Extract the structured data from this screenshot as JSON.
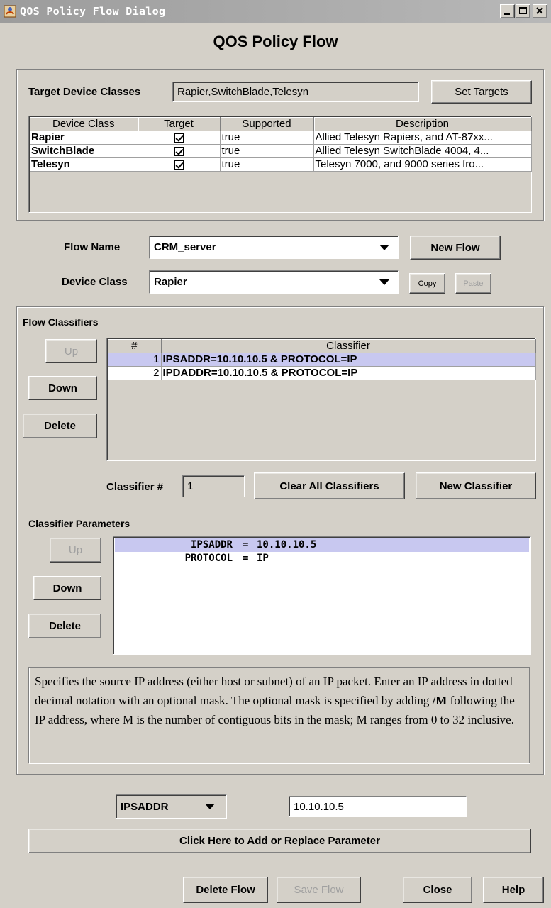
{
  "window": {
    "title": "QOS Policy Flow Dialog"
  },
  "dialog": {
    "heading": "QOS Policy Flow"
  },
  "targets": {
    "label": "Target Device Classes",
    "value": "Rapier,SwitchBlade,Telesyn",
    "set_button": "Set Targets",
    "columns": [
      "Device Class",
      "Target",
      "Supported",
      "Description"
    ],
    "rows": [
      {
        "device_class": "Rapier",
        "target": true,
        "supported": "true",
        "description": "Allied Telesyn Rapiers, and AT-87xx..."
      },
      {
        "device_class": "SwitchBlade",
        "target": true,
        "supported": "true",
        "description": "Allied Telesyn SwitchBlade 4004, 4..."
      },
      {
        "device_class": "Telesyn",
        "target": true,
        "supported": "true",
        "description": "Telesyn 7000, and 9000 series fro..."
      }
    ]
  },
  "flow": {
    "name_label": "Flow Name",
    "name_value": "CRM_server",
    "new_flow_button": "New Flow",
    "device_class_label": "Device Class",
    "device_class_value": "Rapier",
    "copy_button": "Copy",
    "paste_button": "Paste"
  },
  "classifiers": {
    "group_title": "Flow Classifiers",
    "up_button": "Up",
    "down_button": "Down",
    "delete_button": "Delete",
    "columns": [
      "#",
      "Classifier"
    ],
    "rows": [
      {
        "num": "1",
        "classifier": "IPSADDR=10.10.10.5 & PROTOCOL=IP",
        "selected": true
      },
      {
        "num": "2",
        "classifier": "IPDADDR=10.10.10.5 & PROTOCOL=IP",
        "selected": false
      }
    ],
    "classifier_num_label": "Classifier #",
    "classifier_num_value": "1",
    "clear_all_button": "Clear All Classifiers",
    "new_classifier_button": "New Classifier"
  },
  "parameters": {
    "title": "Classifier Parameters",
    "up_button": "Up",
    "down_button": "Down",
    "delete_button": "Delete",
    "items": [
      {
        "name": "IPSADDR",
        "eq": "=",
        "value": "10.10.10.5",
        "selected": true
      },
      {
        "name": "PROTOCOL",
        "eq": "=",
        "value": "IP",
        "selected": false
      }
    ],
    "description_pre": "Specifies the source IP address (either host or subnet) of an IP packet. Enter an IP address in dotted decimal notation with an optional mask. The optional mask is specified by adding ",
    "description_bold": "/M",
    "description_post": " following the IP address, where M is the number of contiguous bits in the mask; M ranges from 0 to 32 inclusive.",
    "param_select": "IPSADDR",
    "param_value": "10.10.10.5",
    "add_replace_button": "Click Here to Add or Replace Parameter"
  },
  "footer": {
    "delete_flow": "Delete Flow",
    "save_flow": "Save Flow",
    "close": "Close",
    "help": "Help"
  }
}
